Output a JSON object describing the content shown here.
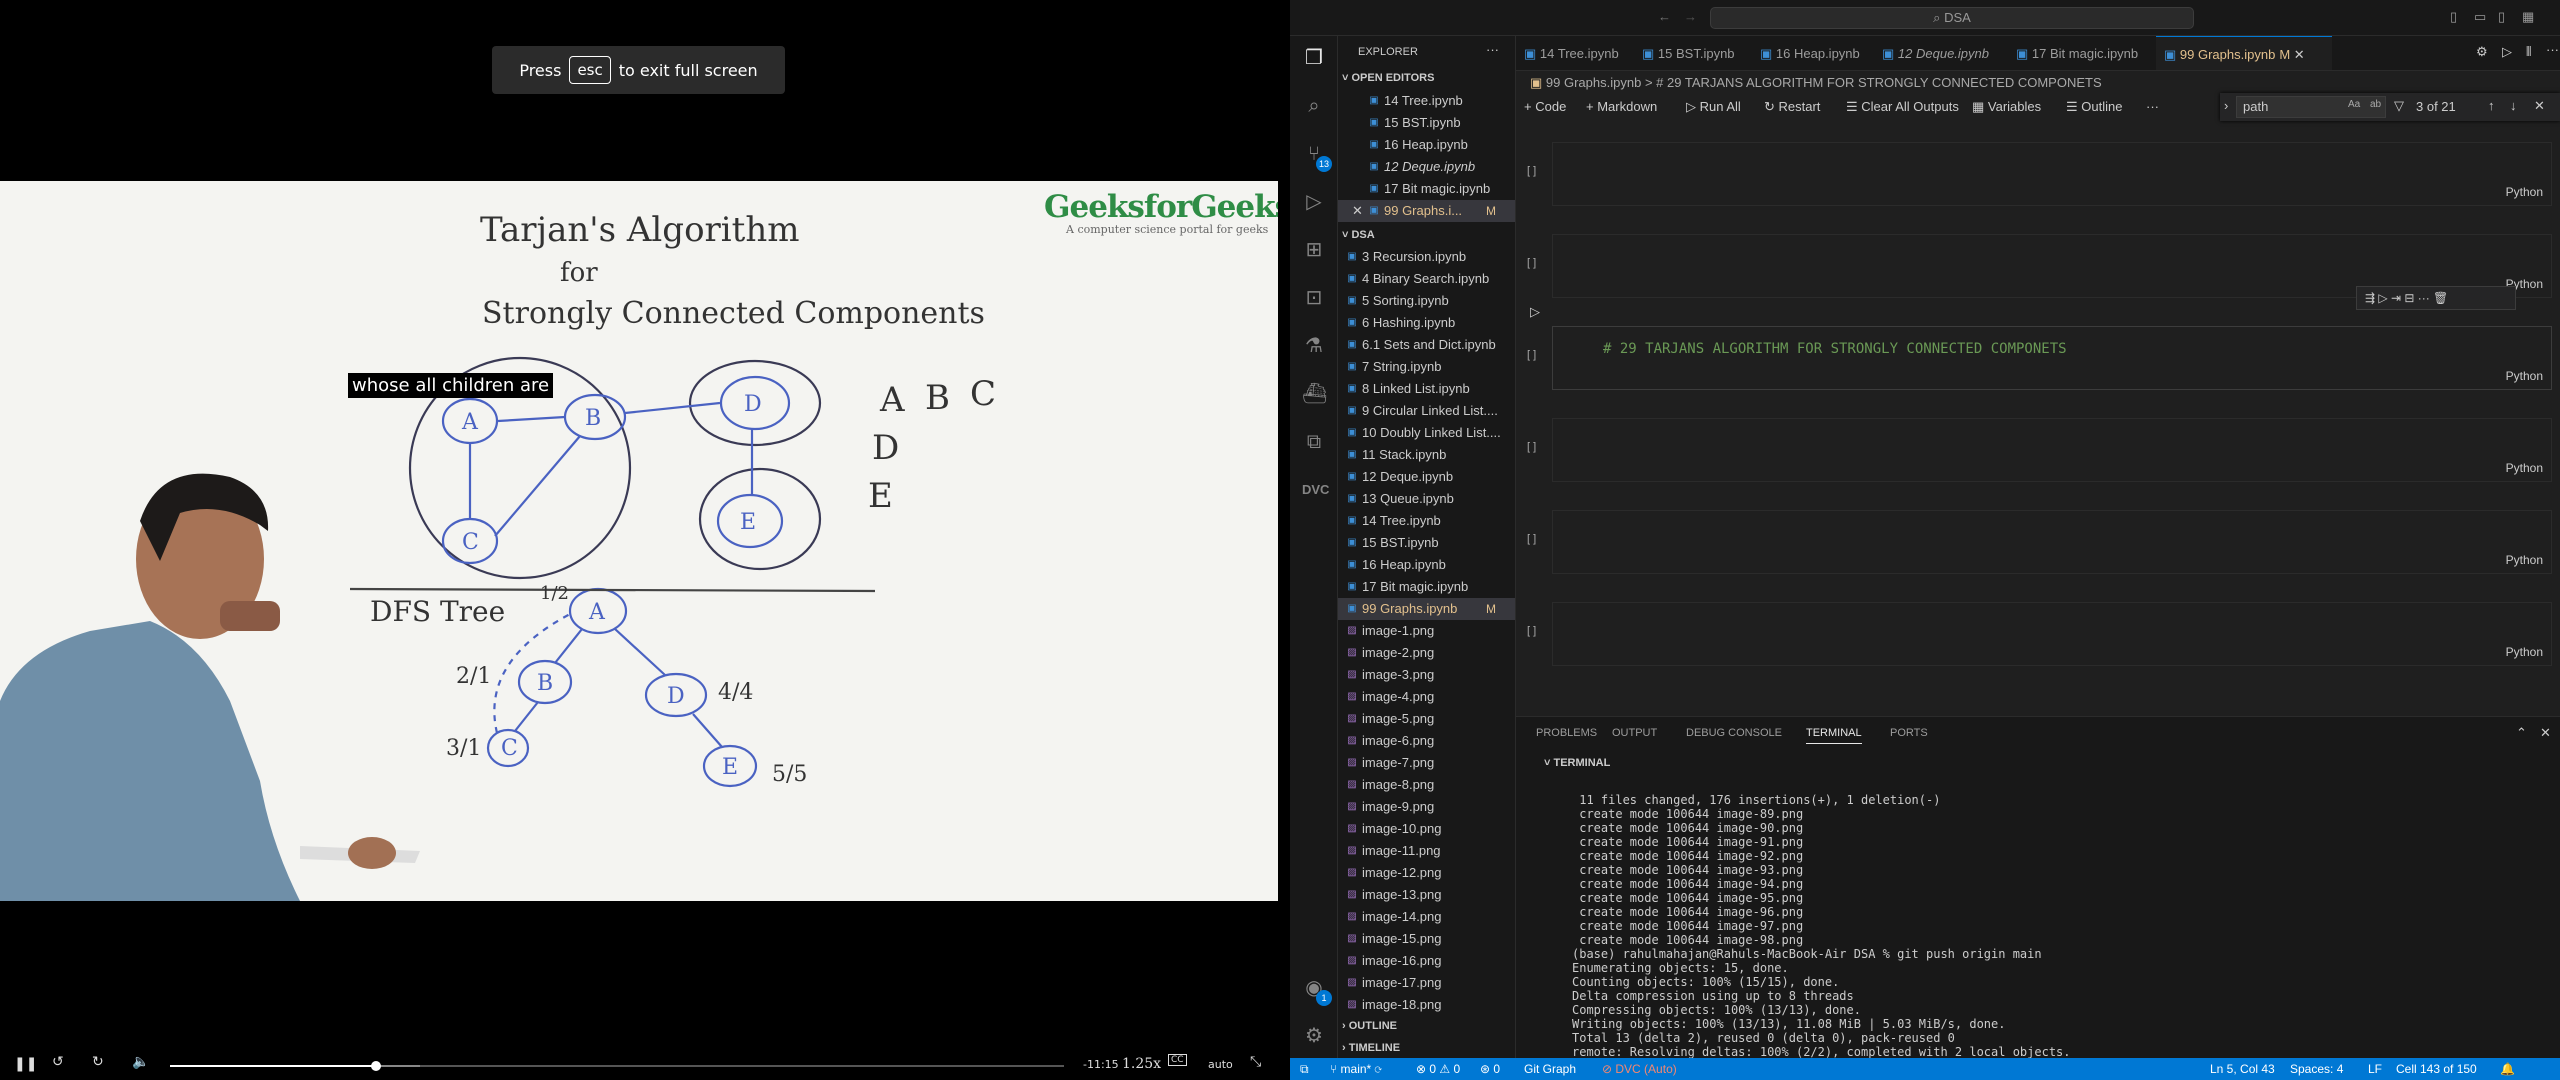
{
  "video": {
    "toast_prefix": "Press",
    "toast_key": "esc",
    "toast_suffix": "to exit full screen",
    "caption": "whose all children are",
    "brand": "GeeksforGeeks",
    "brand_tagline": "A computer science portal for geeks",
    "whiteboard": {
      "title_1": "Tarjan's Algorithm",
      "title_2": "for",
      "title_3": "Strongly Connected Components",
      "nodes": [
        "A",
        "B",
        "C",
        "D",
        "E"
      ],
      "side_letters": [
        "A",
        "B",
        "C",
        "D",
        "E"
      ],
      "dfs_label": "DFS Tree",
      "dfs_nodes": [
        "A",
        "B",
        "C",
        "D",
        "E"
      ],
      "labels": [
        "1/2",
        "2/1",
        "3/1",
        "4/4",
        "5/5"
      ]
    },
    "time_remaining": "-11:15",
    "speed": "1.25x",
    "quality": "auto",
    "progress": 0.23
  },
  "vscode": {
    "search": "DSA",
    "explorer_title": "EXPLORER",
    "open_editors_title": "OPEN EDITORS",
    "open_editors": [
      {
        "name": "14 Tree.ipynb",
        "state": ""
      },
      {
        "name": "15 BST.ipynb",
        "state": ""
      },
      {
        "name": "16 Heap.ipynb",
        "state": ""
      },
      {
        "name": "12 Deque.ipynb",
        "state": ""
      },
      {
        "name": "17 Bit magic.ipynb",
        "state": ""
      },
      {
        "name": "99 Graphs.i...",
        "state": "M"
      }
    ],
    "folder_title": "DSA",
    "files": [
      "3 Recursion.ipynb",
      "4 Binary Search.ipynb",
      "5 Sorting.ipynb",
      "6 Hashing.ipynb",
      "6.1 Sets and Dict.ipynb",
      "7 String.ipynb",
      "8 Linked List.ipynb",
      "9 Circular Linked List....",
      "10 Doubly Linked List....",
      "11 Stack.ipynb",
      "12 Deque.ipynb",
      "13 Queue.ipynb",
      "14 Tree.ipynb",
      "15 BST.ipynb",
      "16 Heap.ipynb",
      "17 Bit magic.ipynb",
      "99 Graphs.ipynb",
      "image-1.png",
      "image-2.png",
      "image-3.png",
      "image-4.png",
      "image-5.png",
      "image-6.png",
      "image-7.png",
      "image-8.png",
      "image-9.png",
      "image-10.png",
      "image-11.png",
      "image-12.png",
      "image-13.png",
      "image-14.png",
      "image-15.png",
      "image-16.png",
      "image-17.png",
      "image-18.png"
    ],
    "modified_flag": "M",
    "outline_title": "OUTLINE",
    "timeline_title": "TIMELINE",
    "source_control_badge": "13",
    "account_badge": "1",
    "tabs": [
      "14 Tree.ipynb",
      "15 BST.ipynb",
      "16 Heap.ipynb",
      "12 Deque.ipynb",
      "17 Bit magic.ipynb",
      "99 Graphs.ipynb"
    ],
    "active_tab_flag": "M",
    "breadcrumb_file": "99 Graphs.ipynb",
    "breadcrumb_sep": ">",
    "breadcrumb_cell": "# 29 TARJANS ALGORITHM FOR STRONGLY CONNECTED COMPONETS",
    "toolbar": {
      "code": "Code",
      "markdown": "Markdown",
      "run_all": "Run All",
      "restart": "Restart",
      "clear": "Clear All Outputs",
      "variables": "Variables",
      "outline": "Outline",
      "more": "···"
    },
    "find": {
      "value": "path",
      "count": "3 of 21"
    },
    "cells": [
      {
        "bracket": "[ ]",
        "lang": "Python",
        "code": ""
      },
      {
        "bracket": "[ ]",
        "lang": "Python",
        "code": ""
      },
      {
        "bracket": "[ ]",
        "lang": "Python",
        "code": "# 29 TARJANS ALGORITHM FOR STRONGLY CONNECTED COMPONETS"
      },
      {
        "bracket": "[ ]",
        "lang": "Python",
        "code": ""
      },
      {
        "bracket": "[ ]",
        "lang": "Python",
        "code": ""
      },
      {
        "bracket": "[ ]",
        "lang": "Python",
        "code": ""
      }
    ],
    "panel_tabs": [
      "PROBLEMS",
      "OUTPUT",
      "DEBUG CONSOLE",
      "TERMINAL",
      "PORTS"
    ],
    "terminal_title": "TERMINAL",
    "terminal_lines": [
      " 11 files changed, 176 insertions(+), 1 deletion(-)",
      " create mode 100644 image-89.png",
      " create mode 100644 image-90.png",
      " create mode 100644 image-91.png",
      " create mode 100644 image-92.png",
      " create mode 100644 image-93.png",
      " create mode 100644 image-94.png",
      " create mode 100644 image-95.png",
      " create mode 100644 image-96.png",
      " create mode 100644 image-97.png",
      " create mode 100644 image-98.png",
      "(base) rahulmahajan@Rahuls-MacBook-Air DSA % git push origin main",
      "Enumerating objects: 15, done.",
      "Counting objects: 100% (15/15), done.",
      "Delta compression using up to 8 threads",
      "Compressing objects: 100% (13/13), done.",
      "Writing objects: 100% (13/13), 11.08 MiB | 5.03 MiB/s, done.",
      "Total 13 (delta 2), reused 0 (delta 0), pack-reused 0",
      "remote: Resolving deltas: 100% (2/2), completed with 2 local objects."
    ],
    "status": {
      "branch": "main*",
      "errors": "0",
      "warnings": "0",
      "ports": "0",
      "git_graph": "Git Graph",
      "dvc": "DVC (Auto)",
      "position": "Ln 5, Col 43",
      "spaces": "Spaces: 4",
      "eol": "LF",
      "cell": "Cell 143 of 150"
    }
  }
}
